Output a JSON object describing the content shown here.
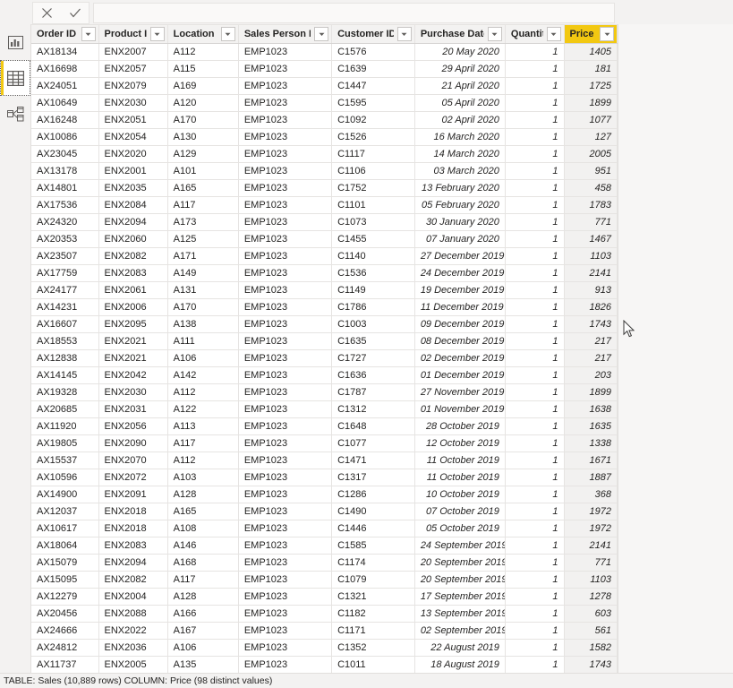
{
  "formula_bar": {
    "cancel_label": "Cancel",
    "commit_label": "Commit",
    "value": "",
    "placeholder": ""
  },
  "nav_rail": {
    "items": [
      {
        "name": "report-view",
        "label": "Report view",
        "icon": "bar-chart-icon",
        "selected": false
      },
      {
        "name": "data-view",
        "label": "Data view",
        "icon": "table-grid-icon",
        "selected": true
      },
      {
        "name": "model-view",
        "label": "Model view",
        "icon": "relationships-icon",
        "selected": false
      }
    ]
  },
  "grid": {
    "columns": [
      {
        "key": "order_id",
        "label": "Order ID",
        "align": "left",
        "selected": false
      },
      {
        "key": "product_id",
        "label": "Product ID",
        "align": "left",
        "selected": false
      },
      {
        "key": "location_id",
        "label": "Location ID",
        "align": "left",
        "selected": false
      },
      {
        "key": "sales_person_id",
        "label": "Sales Person ID",
        "align": "left",
        "selected": false
      },
      {
        "key": "customer_id",
        "label": "Customer ID",
        "align": "left",
        "selected": false
      },
      {
        "key": "purchase_date",
        "label": "Purchase Date",
        "align": "right",
        "selected": false
      },
      {
        "key": "quantity",
        "label": "Quantity",
        "align": "right",
        "selected": false
      },
      {
        "key": "price",
        "label": "Price",
        "align": "right",
        "selected": true
      }
    ],
    "rows": [
      [
        "AX18134",
        "ENX2007",
        "A112",
        "EMP1023",
        "C1576",
        "20 May 2020",
        "1",
        "1405"
      ],
      [
        "AX16698",
        "ENX2057",
        "A115",
        "EMP1023",
        "C1639",
        "29 April 2020",
        "1",
        "181"
      ],
      [
        "AX24051",
        "ENX2079",
        "A169",
        "EMP1023",
        "C1447",
        "21 April 2020",
        "1",
        "1725"
      ],
      [
        "AX10649",
        "ENX2030",
        "A120",
        "EMP1023",
        "C1595",
        "05 April 2020",
        "1",
        "1899"
      ],
      [
        "AX16248",
        "ENX2051",
        "A170",
        "EMP1023",
        "C1092",
        "02 April 2020",
        "1",
        "1077"
      ],
      [
        "AX10086",
        "ENX2054",
        "A130",
        "EMP1023",
        "C1526",
        "16 March 2020",
        "1",
        "127"
      ],
      [
        "AX23045",
        "ENX2020",
        "A129",
        "EMP1023",
        "C1117",
        "14 March 2020",
        "1",
        "2005"
      ],
      [
        "AX13178",
        "ENX2001",
        "A101",
        "EMP1023",
        "C1106",
        "03 March 2020",
        "1",
        "951"
      ],
      [
        "AX14801",
        "ENX2035",
        "A165",
        "EMP1023",
        "C1752",
        "13 February 2020",
        "1",
        "458"
      ],
      [
        "AX17536",
        "ENX2084",
        "A117",
        "EMP1023",
        "C1101",
        "05 February 2020",
        "1",
        "1783"
      ],
      [
        "AX24320",
        "ENX2094",
        "A173",
        "EMP1023",
        "C1073",
        "30 January 2020",
        "1",
        "771"
      ],
      [
        "AX20353",
        "ENX2060",
        "A125",
        "EMP1023",
        "C1455",
        "07 January 2020",
        "1",
        "1467"
      ],
      [
        "AX23507",
        "ENX2082",
        "A171",
        "EMP1023",
        "C1140",
        "27 December 2019",
        "1",
        "1103"
      ],
      [
        "AX17759",
        "ENX2083",
        "A149",
        "EMP1023",
        "C1536",
        "24 December 2019",
        "1",
        "2141"
      ],
      [
        "AX24177",
        "ENX2061",
        "A131",
        "EMP1023",
        "C1149",
        "19 December 2019",
        "1",
        "913"
      ],
      [
        "AX14231",
        "ENX2006",
        "A170",
        "EMP1023",
        "C1786",
        "11 December 2019",
        "1",
        "1826"
      ],
      [
        "AX16607",
        "ENX2095",
        "A138",
        "EMP1023",
        "C1003",
        "09 December 2019",
        "1",
        "1743"
      ],
      [
        "AX18553",
        "ENX2021",
        "A111",
        "EMP1023",
        "C1635",
        "08 December 2019",
        "1",
        "217"
      ],
      [
        "AX12838",
        "ENX2021",
        "A106",
        "EMP1023",
        "C1727",
        "02 December 2019",
        "1",
        "217"
      ],
      [
        "AX14145",
        "ENX2042",
        "A142",
        "EMP1023",
        "C1636",
        "01 December 2019",
        "1",
        "203"
      ],
      [
        "AX19328",
        "ENX2030",
        "A112",
        "EMP1023",
        "C1787",
        "27 November 2019",
        "1",
        "1899"
      ],
      [
        "AX20685",
        "ENX2031",
        "A122",
        "EMP1023",
        "C1312",
        "01 November 2019",
        "1",
        "1638"
      ],
      [
        "AX11920",
        "ENX2056",
        "A113",
        "EMP1023",
        "C1648",
        "28 October 2019",
        "1",
        "1635"
      ],
      [
        "AX19805",
        "ENX2090",
        "A117",
        "EMP1023",
        "C1077",
        "12 October 2019",
        "1",
        "1338"
      ],
      [
        "AX15537",
        "ENX2070",
        "A112",
        "EMP1023",
        "C1471",
        "11 October 2019",
        "1",
        "1671"
      ],
      [
        "AX10596",
        "ENX2072",
        "A103",
        "EMP1023",
        "C1317",
        "11 October 2019",
        "1",
        "1887"
      ],
      [
        "AX14900",
        "ENX2091",
        "A128",
        "EMP1023",
        "C1286",
        "10 October 2019",
        "1",
        "368"
      ],
      [
        "AX12037",
        "ENX2018",
        "A165",
        "EMP1023",
        "C1490",
        "07 October 2019",
        "1",
        "1972"
      ],
      [
        "AX10617",
        "ENX2018",
        "A108",
        "EMP1023",
        "C1446",
        "05 October 2019",
        "1",
        "1972"
      ],
      [
        "AX18064",
        "ENX2083",
        "A146",
        "EMP1023",
        "C1585",
        "24 September 2019",
        "1",
        "2141"
      ],
      [
        "AX15079",
        "ENX2094",
        "A168",
        "EMP1023",
        "C1174",
        "20 September 2019",
        "1",
        "771"
      ],
      [
        "AX15095",
        "ENX2082",
        "A117",
        "EMP1023",
        "C1079",
        "20 September 2019",
        "1",
        "1103"
      ],
      [
        "AX12279",
        "ENX2004",
        "A128",
        "EMP1023",
        "C1321",
        "17 September 2019",
        "1",
        "1278"
      ],
      [
        "AX20456",
        "ENX2088",
        "A166",
        "EMP1023",
        "C1182",
        "13 September 2019",
        "1",
        "603"
      ],
      [
        "AX24666",
        "ENX2022",
        "A167",
        "EMP1023",
        "C1171",
        "02 September 2019",
        "1",
        "561"
      ],
      [
        "AX24812",
        "ENX2036",
        "A106",
        "EMP1023",
        "C1352",
        "22 August 2019",
        "1",
        "1582"
      ],
      [
        "AX11737",
        "ENX2005",
        "A135",
        "EMP1023",
        "C1011",
        "18 August 2019",
        "1",
        "1743"
      ]
    ]
  },
  "status_bar": {
    "text": "TABLE: Sales (10,889 rows) COLUMN: Price (98 distinct values)"
  },
  "colors": {
    "accent_selected_header": "#F2C811",
    "chrome_background": "#F3F2F1",
    "grid_background": "#FFFFFF",
    "selected_column_cell": "#F2F1F0"
  }
}
